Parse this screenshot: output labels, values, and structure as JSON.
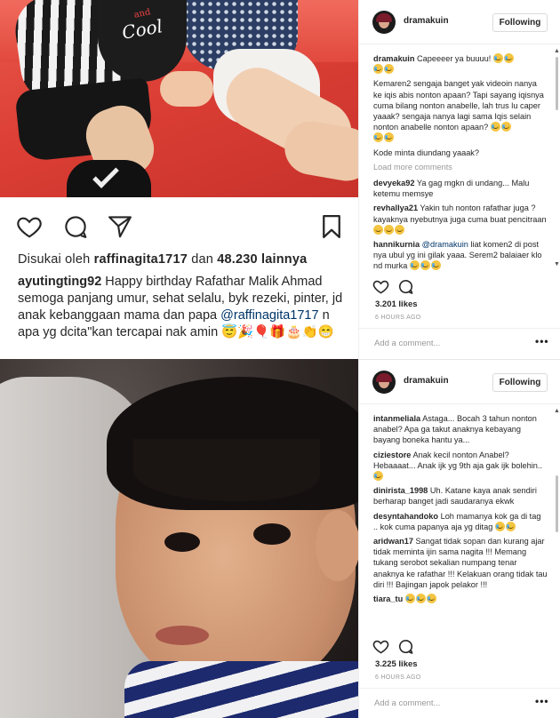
{
  "left_post": {
    "bib_small": "and",
    "bib_big": "Cool",
    "liked_prefix": "Disukai oleh ",
    "liked_user": "raffinagita1717",
    "liked_and": " dan ",
    "liked_count": "48.230 lainnya",
    "caption_user": "ayutingting92",
    "caption_text": " Happy birthday Rafathar Malik Ahmad semoga panjang umur, sehat selalu, byk rezeki, pinter, jd anak kebanggaan mama dan papa ",
    "caption_mention": "@raffinagita1717",
    "caption_text2": " n apa yg dcita\"kan tercapai nak amin",
    "caption_emojis": "😇🎉🎈🎁🎂👏😁"
  },
  "top_panel": {
    "username": "dramakuin",
    "follow_label": "Following",
    "owner_comment": "Capeeeer ya buuuu!",
    "owner_comment2": "Kemaren2 sengaja banget yak videoin nanya ke iqis abis nonton apaan? Tapi sayang iqisnya cuma bilang nonton anabelle, lah trus lu caper yaaak? sengaja nanya lagi sama Iqis selain nonton anabelle nonton apaan?",
    "owner_comment3": "Kode minta diundang yaaak?",
    "load_more": "Load more comments",
    "comments": [
      {
        "user": "devyeka92",
        "text": "Ya gag mgkn di undang... Malu ketemu memsye"
      },
      {
        "user": "revhallya21",
        "text": "Yakin tuh nonton rafathar juga ? kayaknya nyebutnya juga cuma buat pencitraan"
      },
      {
        "user": "hannikurnia",
        "mention": "@dramakuin",
        "text": "liat komen2 di post nya ubul yg ini gilak yaaa. Serem2 balaiaer klo nd murka"
      }
    ],
    "likes": "3.201 likes",
    "ago": "6 HOURS AGO",
    "add_comment": "Add a comment...",
    "more": "•••"
  },
  "bottom_panel": {
    "username": "dramakuin",
    "follow_label": "Following",
    "comments": [
      {
        "user": "intanmeliala",
        "text": "Astaga... Bocah 3 tahun nonton anabel? Apa ga takut anaknya kebayang bayang boneka hantu ya..."
      },
      {
        "user": "ciziestore",
        "text": "Anak kecil nonton Anabel? Hebaaaat... Anak ijk yg 9th aja gak ijk bolehin.."
      },
      {
        "user": "dinirista_1998",
        "text": "Uh. Katane kaya anak sendiri berharap banget jadi saudaranya ekwk"
      },
      {
        "user": "desyntahandoko",
        "text": "Loh mamanya kok ga di tag .. kok cuma papanya aja yg ditag"
      },
      {
        "user": "aridwan17",
        "text": "Sangat tidak sopan dan kurang ajar tidak meminta ijin sama nagita !!! Memang tukang serobot sekalian numpang tenar anaknya ke rafathar !!! Kelakuan orang tidak tau diri !!! Bajingan japok pelakor !!!"
      },
      {
        "user": "tiara_tu",
        "text": ""
      }
    ],
    "likes": "3.225 likes",
    "ago": "6 HOURS AGO",
    "add_comment": "Add a comment...",
    "more": "•••"
  },
  "colors": {
    "link": "#003569",
    "muted": "#999999",
    "text": "#262626"
  },
  "icons": [
    "heart-icon",
    "comment-icon",
    "share-icon",
    "bookmark-icon"
  ]
}
